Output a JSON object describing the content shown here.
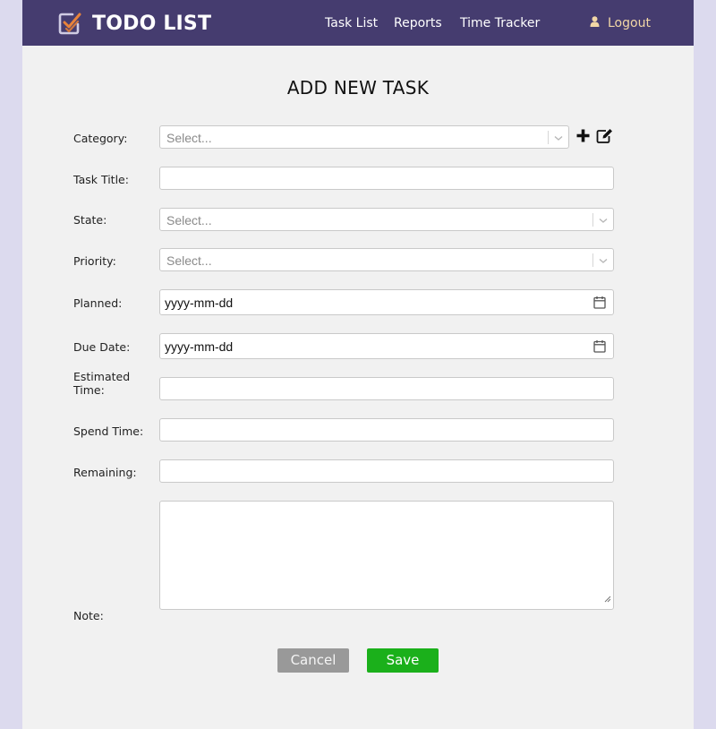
{
  "app": {
    "brand": "TODO LIST"
  },
  "nav": {
    "links": [
      "Task List",
      "Reports",
      "Time Tracker"
    ],
    "logout": "Logout"
  },
  "form": {
    "title": "ADD NEW TASK",
    "fields": {
      "category": {
        "label": "Category:",
        "placeholder": "Select..."
      },
      "task_title": {
        "label": "Task Title:",
        "value": ""
      },
      "state": {
        "label": "State:",
        "placeholder": "Select..."
      },
      "priority": {
        "label": "Priority:",
        "placeholder": "Select..."
      },
      "planned": {
        "label": "Planned:",
        "value": "yyyy-mm-dd"
      },
      "due_date": {
        "label": "Due Date:",
        "value": "yyyy-mm-dd"
      },
      "estimated_time": {
        "label_line1": "Estimated",
        "label_line2": "Time:",
        "value": ""
      },
      "spend_time": {
        "label": "Spend Time:",
        "value": ""
      },
      "remaining": {
        "label": "Remaining:",
        "value": ""
      },
      "note": {
        "label": "Note:",
        "value": ""
      }
    },
    "buttons": {
      "cancel": "Cancel",
      "save": "Save"
    }
  },
  "colors": {
    "navbar": "#453c6f",
    "background": "#dcdaee",
    "panel": "#f1f1f1",
    "save": "#1bb01b",
    "cancel": "#999999",
    "logout": "#f2d7a6",
    "logo_accent": "#e8833a"
  }
}
